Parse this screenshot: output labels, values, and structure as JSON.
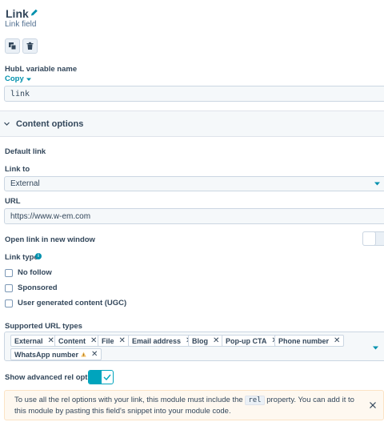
{
  "header": {
    "title": "Link",
    "subtitle": "Link field"
  },
  "hubl": {
    "label": "HubL variable name",
    "copy_label": "Copy",
    "value": "link"
  },
  "content_options": {
    "title": "Content options"
  },
  "default_link": {
    "label": "Default link",
    "link_to_label": "Link to",
    "link_to_value": "External",
    "url_label": "URL",
    "url_value": "https://www.w-em.com",
    "open_new_window_label": "Open link in new window",
    "open_new_window": false
  },
  "link_type": {
    "label": "Link type",
    "options": [
      {
        "label": "No follow",
        "checked": false
      },
      {
        "label": "Sponsored",
        "checked": false
      },
      {
        "label": "User generated content (UGC)",
        "checked": false
      }
    ]
  },
  "supported_url_types": {
    "label": "Supported URL types",
    "tags": [
      "External",
      "Content",
      "File",
      "Email address",
      "Blog",
      "Pop-up CTA",
      "Phone number",
      "WhatsApp number"
    ],
    "warning_tag": "WhatsApp number"
  },
  "advanced_rel": {
    "label": "Show advanced rel options",
    "enabled": true
  },
  "alert": {
    "text_before": "To use all the rel options with your link, this module must include the ",
    "code": "rel",
    "text_after": " property. You can add it to this module by pasting this field's snippet into your module code."
  },
  "colors": {
    "accent": "#0091ae",
    "toggle_on": "#00a4bd",
    "text": "#33475b",
    "alert_bg": "#fef8f0",
    "warning": "#f5c26b"
  },
  "icons": {
    "edit": "pencil-icon",
    "clone": "clone-icon",
    "delete": "trash-icon",
    "info": "info-icon",
    "warning": "warning-icon",
    "close": "close-icon"
  }
}
